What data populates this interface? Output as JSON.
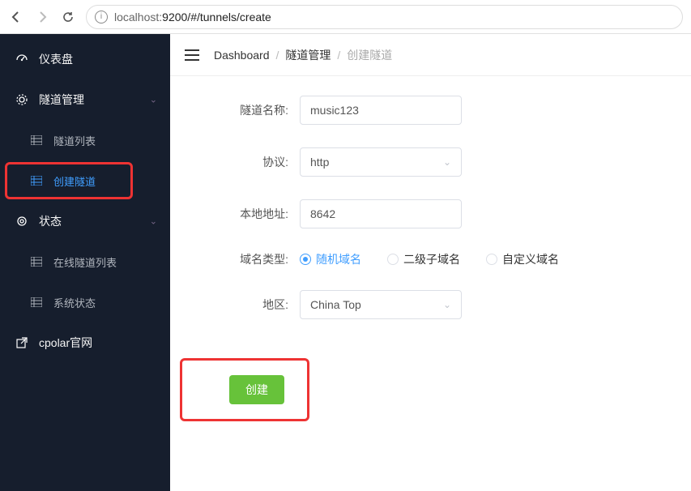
{
  "browser": {
    "url_host": "localhost:",
    "url_port_path": "9200/#/tunnels/create"
  },
  "sidebar": {
    "items": [
      {
        "label": "仪表盘",
        "icon": "dashboard"
      },
      {
        "label": "隧道管理",
        "icon": "gear",
        "expandable": true
      },
      {
        "label": "隧道列表",
        "icon": "grid",
        "child": true
      },
      {
        "label": "创建隧道",
        "icon": "grid",
        "child": true,
        "active": true
      },
      {
        "label": "状态",
        "icon": "circle",
        "expandable": true
      },
      {
        "label": "在线隧道列表",
        "icon": "grid",
        "child": true
      },
      {
        "label": "系统状态",
        "icon": "grid",
        "child": true
      },
      {
        "label": "cpolar官网",
        "icon": "external"
      }
    ]
  },
  "breadcrumb": {
    "items": [
      "Dashboard",
      "隧道管理",
      "创建隧道"
    ]
  },
  "form": {
    "name_label": "隧道名称:",
    "name_value": "music123",
    "protocol_label": "协议:",
    "protocol_value": "http",
    "local_addr_label": "本地地址:",
    "local_addr_value": "8642",
    "domain_type_label": "域名类型:",
    "domain_options": [
      "随机域名",
      "二级子域名",
      "自定义域名"
    ],
    "region_label": "地区:",
    "region_value": "China Top",
    "submit_label": "创建"
  }
}
